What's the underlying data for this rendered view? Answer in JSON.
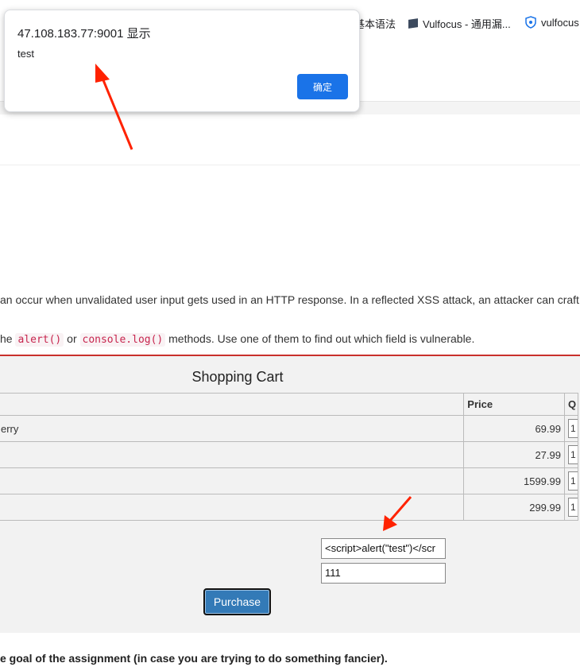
{
  "bookmarks": [
    {
      "label": "基本语法"
    },
    {
      "label": "Vulfocus - 通用漏..."
    },
    {
      "label": "vulfocus"
    }
  ],
  "intro": {
    "line1": "an occur when unvalidated user input gets used in an HTTP response. In a reflected XSS attack, an attacker can craft a",
    "line2_prefix": "he",
    "code1": "alert()",
    "or": "or",
    "code2": "console.log()",
    "line2_suffix": "methods. Use one of them to find out which field is vulnerable."
  },
  "cart": {
    "title": "Shopping Cart",
    "headers": {
      "price": "Price",
      "qty": "Q"
    },
    "rows": [
      {
        "item": "erry",
        "price": "69.99",
        "qty": "1"
      },
      {
        "item": "",
        "price": "27.99",
        "qty": "1"
      },
      {
        "item": "",
        "price": "1599.99",
        "qty": "1"
      },
      {
        "item": "",
        "price": "299.99",
        "qty": "1"
      }
    ],
    "field1_value": "<script>alert(\"test\")</scr",
    "field2_value": "111",
    "purchase_label": "Purchase"
  },
  "footer_note": "e goal of the assignment (in case you are trying to do something fancier).",
  "dialog": {
    "title": "47.108.183.77:9001 显示",
    "message": "test",
    "ok_label": "确定"
  },
  "colors": {
    "accent": "#1a73e8",
    "purchase": "#337ab7",
    "annotation_arrow": "#ff2200",
    "code_text": "#c7254e"
  }
}
